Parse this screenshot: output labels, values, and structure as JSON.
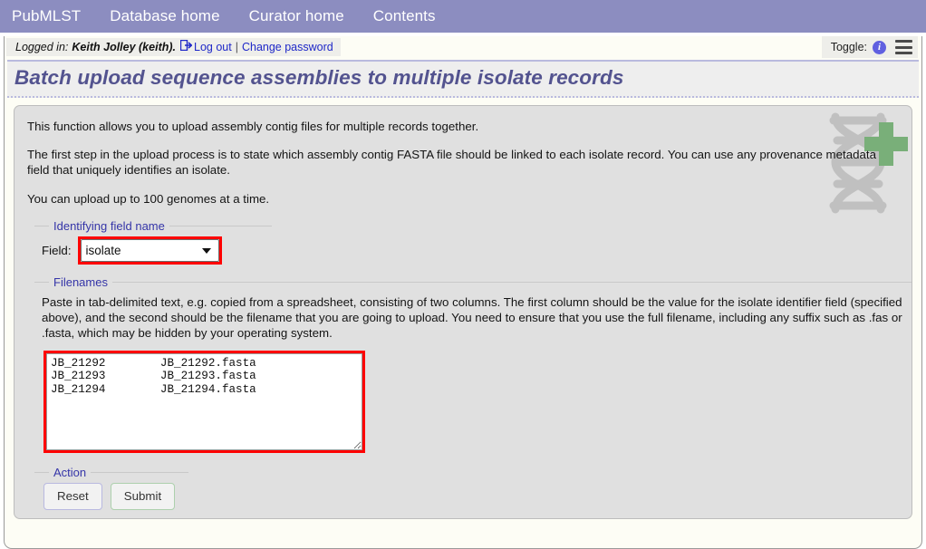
{
  "nav": {
    "items": [
      {
        "label": "PubMLST",
        "name": "nav-pubmlst"
      },
      {
        "label": "Database home",
        "name": "nav-database-home"
      },
      {
        "label": "Curator home",
        "name": "nav-curator-home"
      },
      {
        "label": "Contents",
        "name": "nav-contents"
      }
    ]
  },
  "login": {
    "prefix": "Logged in:",
    "user": "Keith Jolley (keith).",
    "logout_label": "Log out",
    "separator": "|",
    "change_password_label": "Change password",
    "logout_icon": "logout-arrow-icon"
  },
  "toggle": {
    "label": "Toggle:",
    "info_icon": "info-icon",
    "info_glyph": "i",
    "menu_icon": "hamburger-menu-icon"
  },
  "header": {
    "title": "Batch upload sequence assemblies to multiple isolate records"
  },
  "content": {
    "paragraphs": [
      "This function allows you to upload assembly contig files for multiple records together.",
      "The first step in the upload process is to state which assembly contig FASTA file should be linked to each isolate record. You can use any provenance metadata field that uniquely identifies an isolate.",
      "You can upload up to 100 genomes at a time."
    ],
    "logo_icon": "dna-plus-icon"
  },
  "identifying_field": {
    "legend": "Identifying field name",
    "field_label": "Field:",
    "selected_value": "isolate",
    "options": [
      "isolate"
    ],
    "highlight_color": "#ff0000"
  },
  "filenames": {
    "legend": "Filenames",
    "instructions": "Paste in tab-delimited text, e.g. copied from a spreadsheet, consisting of two columns. The first column should be the value for the isolate identifier field (specified above), and the second should be the filename that you are going to upload. You need to ensure that you use the full filename, including any suffix such as .fas or .fasta, which may be hidden by your operating system.",
    "textarea_value": "JB_21292\tJB_21292.fasta\nJB_21293\tJB_21293.fasta\nJB_21294\tJB_21294.fasta",
    "rows": [
      {
        "identifier": "JB_21292",
        "filename": "JB_21292.fasta"
      },
      {
        "identifier": "JB_21293",
        "filename": "JB_21293.fasta"
      },
      {
        "identifier": "JB_21294",
        "filename": "JB_21294.fasta"
      }
    ],
    "placeholder": "",
    "highlight_color": "#ff0000"
  },
  "action": {
    "legend": "Action",
    "reset_label": "Reset",
    "submit_label": "Submit"
  },
  "colors": {
    "navbar": "#8c8dc0",
    "title_text": "#53538f",
    "legend_text": "#3535a8",
    "link": "#1f28c8",
    "content_bg": "#e0e0e0",
    "page_bg": "#fdfdf5",
    "submit_border": "#add0ad",
    "reset_border": "#b9b9e0"
  }
}
